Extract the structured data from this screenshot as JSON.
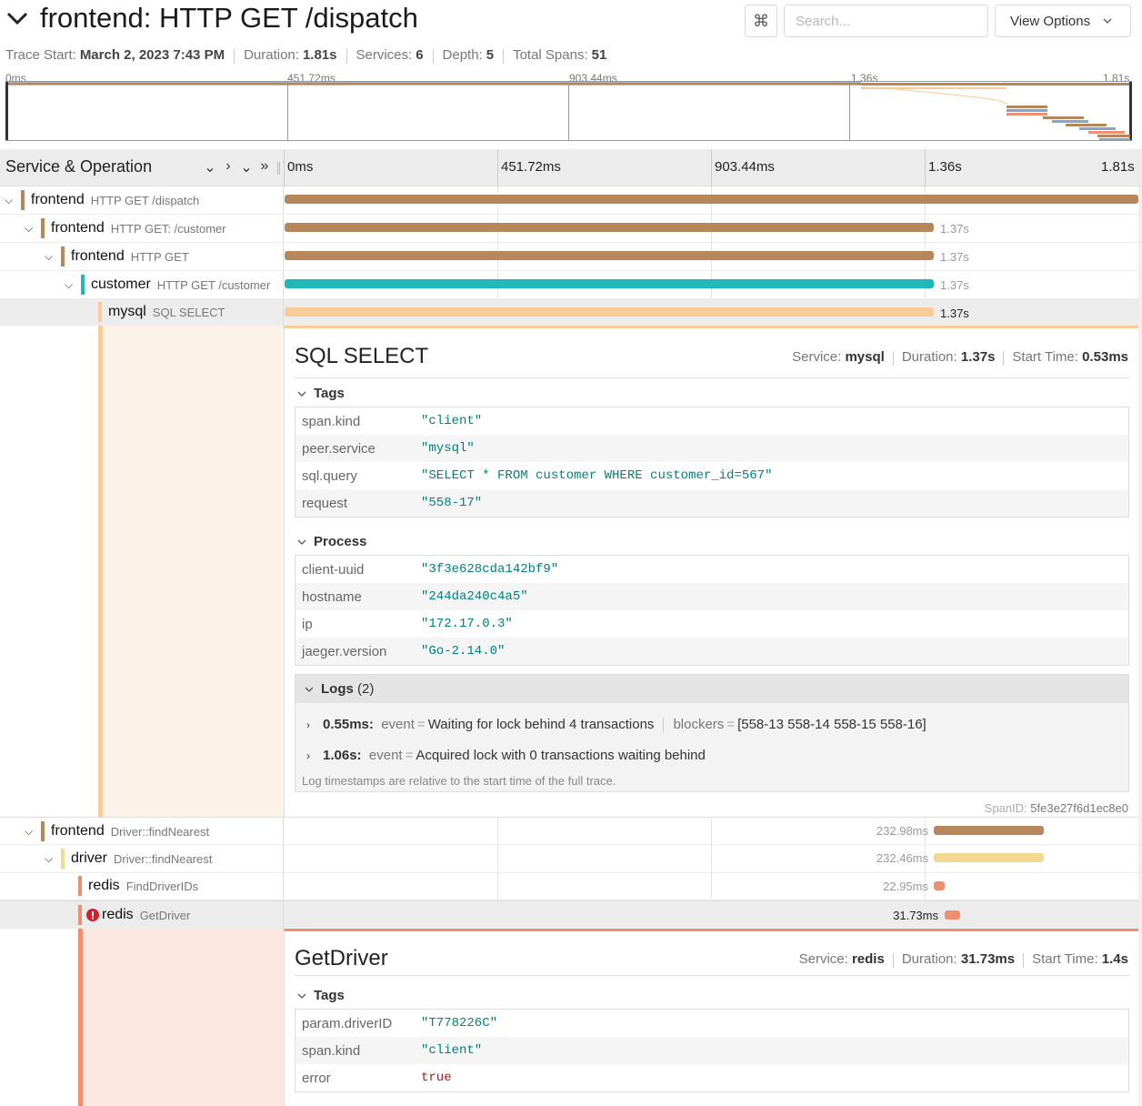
{
  "header": {
    "title": "frontend: HTTP GET /dispatch",
    "kbd_icon": "⌘",
    "search_placeholder": "Search...",
    "view_options_label": "View Options"
  },
  "meta": {
    "trace_start_label": "Trace Start:",
    "trace_start": "March 2, 2023 7:43 PM",
    "duration_label": "Duration:",
    "duration": "1.81s",
    "services_label": "Services:",
    "services": "6",
    "depth_label": "Depth:",
    "depth": "5",
    "total_spans_label": "Total Spans:",
    "total_spans": "51"
  },
  "minimap": {
    "ticks": [
      "0ms",
      "451.72ms",
      "903.44ms",
      "1.36s",
      "1.81s"
    ]
  },
  "table_header": {
    "service_operation": "Service & Operation",
    "ticks": [
      "0ms",
      "451.72ms",
      "903.44ms",
      "1.36s",
      "1.81s"
    ]
  },
  "colors": {
    "frontend": "#b5875b",
    "customer": "#20b7b8",
    "mysql": "#f8cb97",
    "driver": "#f5d890",
    "redis": "#ef8f72",
    "error": "#d0202d"
  },
  "rows": [
    {
      "service": "frontend",
      "operation": "HTTP GET /dispatch",
      "duration_label": ""
    },
    {
      "service": "frontend",
      "operation": "HTTP GET: /customer",
      "duration_label": "1.37s"
    },
    {
      "service": "frontend",
      "operation": "HTTP GET",
      "duration_label": "1.37s"
    },
    {
      "service": "customer",
      "operation": "HTTP GET /customer",
      "duration_label": "1.37s"
    },
    {
      "service": "mysql",
      "operation": "SQL SELECT",
      "duration_label": "1.37s"
    },
    {
      "service": "frontend",
      "operation": "Driver::findNearest",
      "duration_label": "232.98ms"
    },
    {
      "service": "driver",
      "operation": "Driver::findNearest",
      "duration_label": "232.46ms"
    },
    {
      "service": "redis",
      "operation": "FindDriverIDs",
      "duration_label": "22.95ms"
    },
    {
      "service": "redis",
      "operation": "GetDriver",
      "duration_label": "31.73ms"
    }
  ],
  "detail1": {
    "title": "SQL SELECT",
    "service_label": "Service:",
    "service": "mysql",
    "duration_label": "Duration:",
    "duration": "1.37s",
    "start_label": "Start Time:",
    "start": "0.53ms",
    "tags_label": "Tags",
    "tags": [
      {
        "k": "span.kind",
        "v": "\"client\""
      },
      {
        "k": "peer.service",
        "v": "\"mysql\""
      },
      {
        "k": "sql.query",
        "v": "\"SELECT * FROM customer WHERE customer_id=567\""
      },
      {
        "k": "request",
        "v": "\"558-17\""
      }
    ],
    "process_label": "Process",
    "process": [
      {
        "k": "client-uuid",
        "v": "\"3f3e628cda142bf9\""
      },
      {
        "k": "hostname",
        "v": "\"244da240c4a5\""
      },
      {
        "k": "ip",
        "v": "\"172.17.0.3\""
      },
      {
        "k": "jaeger.version",
        "v": "\"Go-2.14.0\""
      }
    ],
    "logs_label": "Logs",
    "logs_count": "(2)",
    "logs": [
      {
        "time": "0.55ms:",
        "k1": "event",
        "v1": "Waiting for lock behind 4 transactions",
        "k2": "blockers",
        "v2": "[558-13 558-14 558-15 558-16]"
      },
      {
        "time": "1.06s:",
        "k1": "event",
        "v1": "Acquired lock with 0 transactions waiting behind"
      }
    ],
    "logs_note": "Log timestamps are relative to the start time of the full trace.",
    "spanid_label": "SpanID:",
    "spanid": "5fe3e27f6d1ec8e0"
  },
  "detail2": {
    "title": "GetDriver",
    "service_label": "Service:",
    "service": "redis",
    "duration_label": "Duration:",
    "duration": "31.73ms",
    "start_label": "Start Time:",
    "start": "1.4s",
    "tags_label": "Tags",
    "tags": [
      {
        "k": "param.driverID",
        "v": "\"T778226C\""
      },
      {
        "k": "span.kind",
        "v": "\"client\""
      },
      {
        "k": "error",
        "v": "true"
      }
    ]
  }
}
